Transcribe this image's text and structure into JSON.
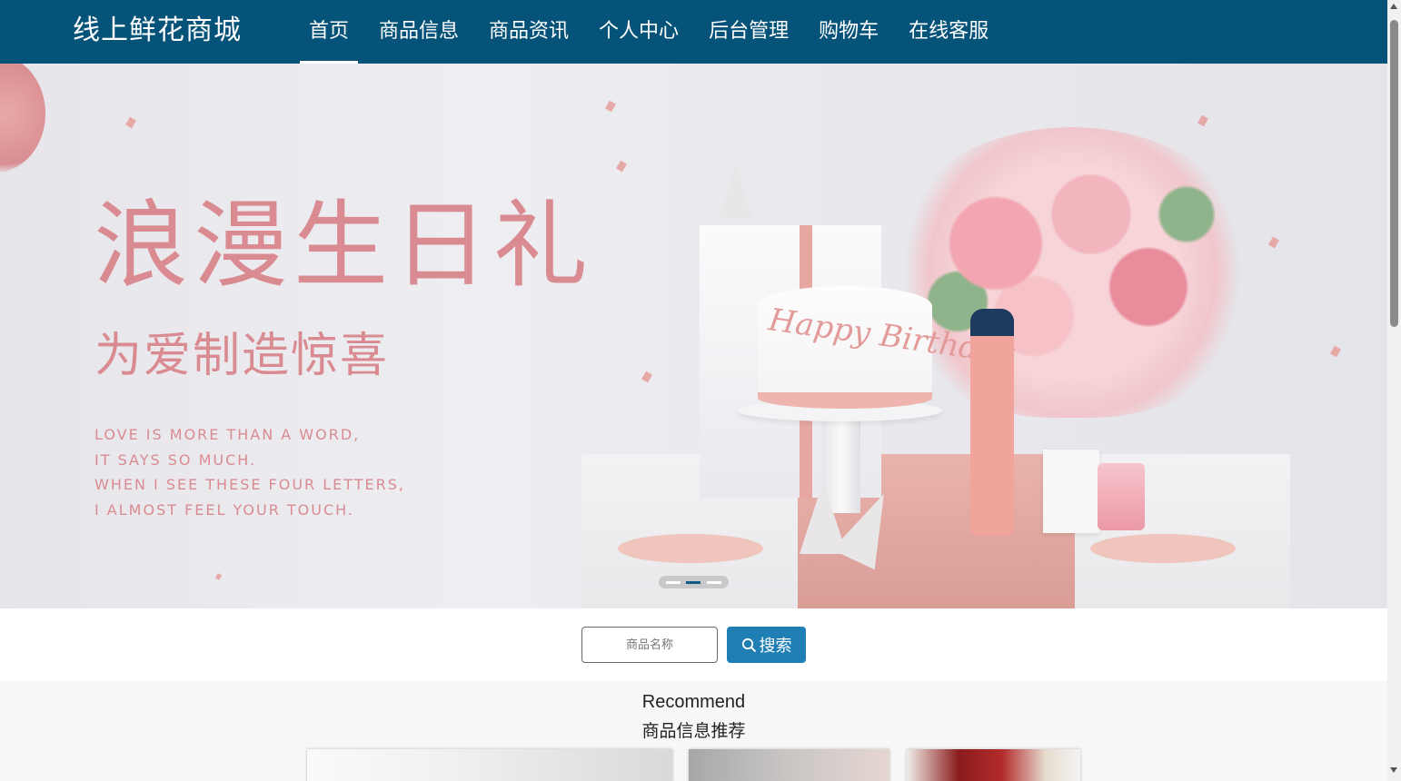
{
  "nav": {
    "brand": "线上鲜花商城",
    "items": [
      {
        "label": "首页",
        "active": true
      },
      {
        "label": "商品信息"
      },
      {
        "label": "商品资讯"
      },
      {
        "label": "个人中心"
      },
      {
        "label": "后台管理"
      },
      {
        "label": "购物车"
      },
      {
        "label": "在线客服"
      }
    ],
    "background_color": "#06537a"
  },
  "banner": {
    "headline": "浪漫生日礼",
    "subline": "为爱制造惊喜",
    "poem": [
      "LOVE IS MORE THAN A WORD,",
      "IT SAYS SO MUCH.",
      "WHEN I SEE THESE FOUR LETTERS,",
      "I ALMOST FEEL YOUR TOUCH."
    ],
    "cake_text": "Happy Birthday",
    "carousel": {
      "slides": 3,
      "active_index": 1
    }
  },
  "search": {
    "placeholder": "商品名称",
    "button_label": "搜索",
    "button_color": "#1f7fb5"
  },
  "recommend": {
    "title_en": "Recommend",
    "title_cn": "商品信息推荐"
  }
}
